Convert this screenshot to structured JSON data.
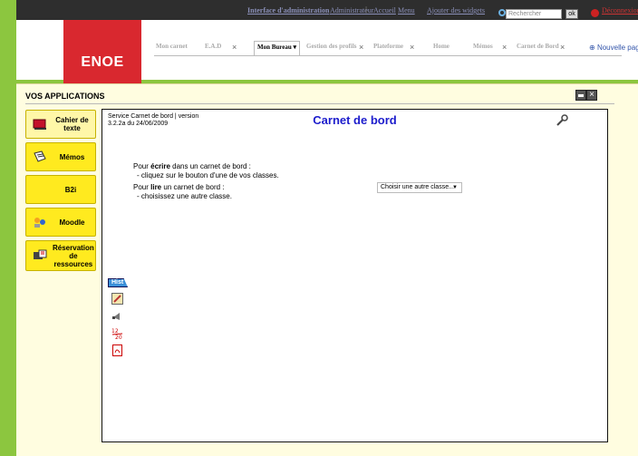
{
  "topbar": {
    "admin_link": "Interface d'administration",
    "user": "Administrateur",
    "accueil": "Accueil",
    "menu": "Menu",
    "ajouter": "Ajouter des widgets",
    "search_placeholder": "Rechercher",
    "ok": "ok",
    "deconnexion": "Déconnexion"
  },
  "logo": "ENOE",
  "tabs": [
    {
      "label": "Mon carnet"
    },
    {
      "label": "E.A.D"
    },
    {
      "label": "Mon Bureau"
    },
    {
      "label": "Gestion des profils"
    },
    {
      "label": "Plateforme"
    },
    {
      "label": "Home"
    },
    {
      "label": "Mémos"
    },
    {
      "label": "Carnet de Bord"
    }
  ],
  "new_page": "Nouvelle page",
  "apps_title": "VOS APPLICATIONS",
  "apps": [
    {
      "label": "Cahier de texte",
      "icon": "notebook-icon"
    },
    {
      "label": "Mémos",
      "icon": "memo-icon"
    },
    {
      "label": "B2i",
      "icon": ""
    },
    {
      "label": "Moodle",
      "icon": "moodle-icon"
    },
    {
      "label": "Réservation de ressources",
      "icon": "reservation-icon"
    }
  ],
  "doc": {
    "service_info": "Service Carnet de bord | version 3.2.2a du 24/06/2009",
    "title": "Carnet de bord",
    "write_pre": "Pour ",
    "write_bold": "écrire",
    "write_post": " dans un carnet de bord :",
    "write_sub": "- cliquez sur le bouton d'une de vos classes.",
    "read_pre": "Pour ",
    "read_bold": "lire",
    "read_post": " un carnet de bord :",
    "read_sub": "- choisissez une autre classe.",
    "select_label": "Choisir une autre classe..."
  },
  "side": {
    "hist": "Hist"
  },
  "colors": {
    "background": "#8cc63f",
    "logo": "#d9282f",
    "title": "#1c1ccc",
    "app_button": "#ffea1f",
    "panel": "#fffde0"
  }
}
